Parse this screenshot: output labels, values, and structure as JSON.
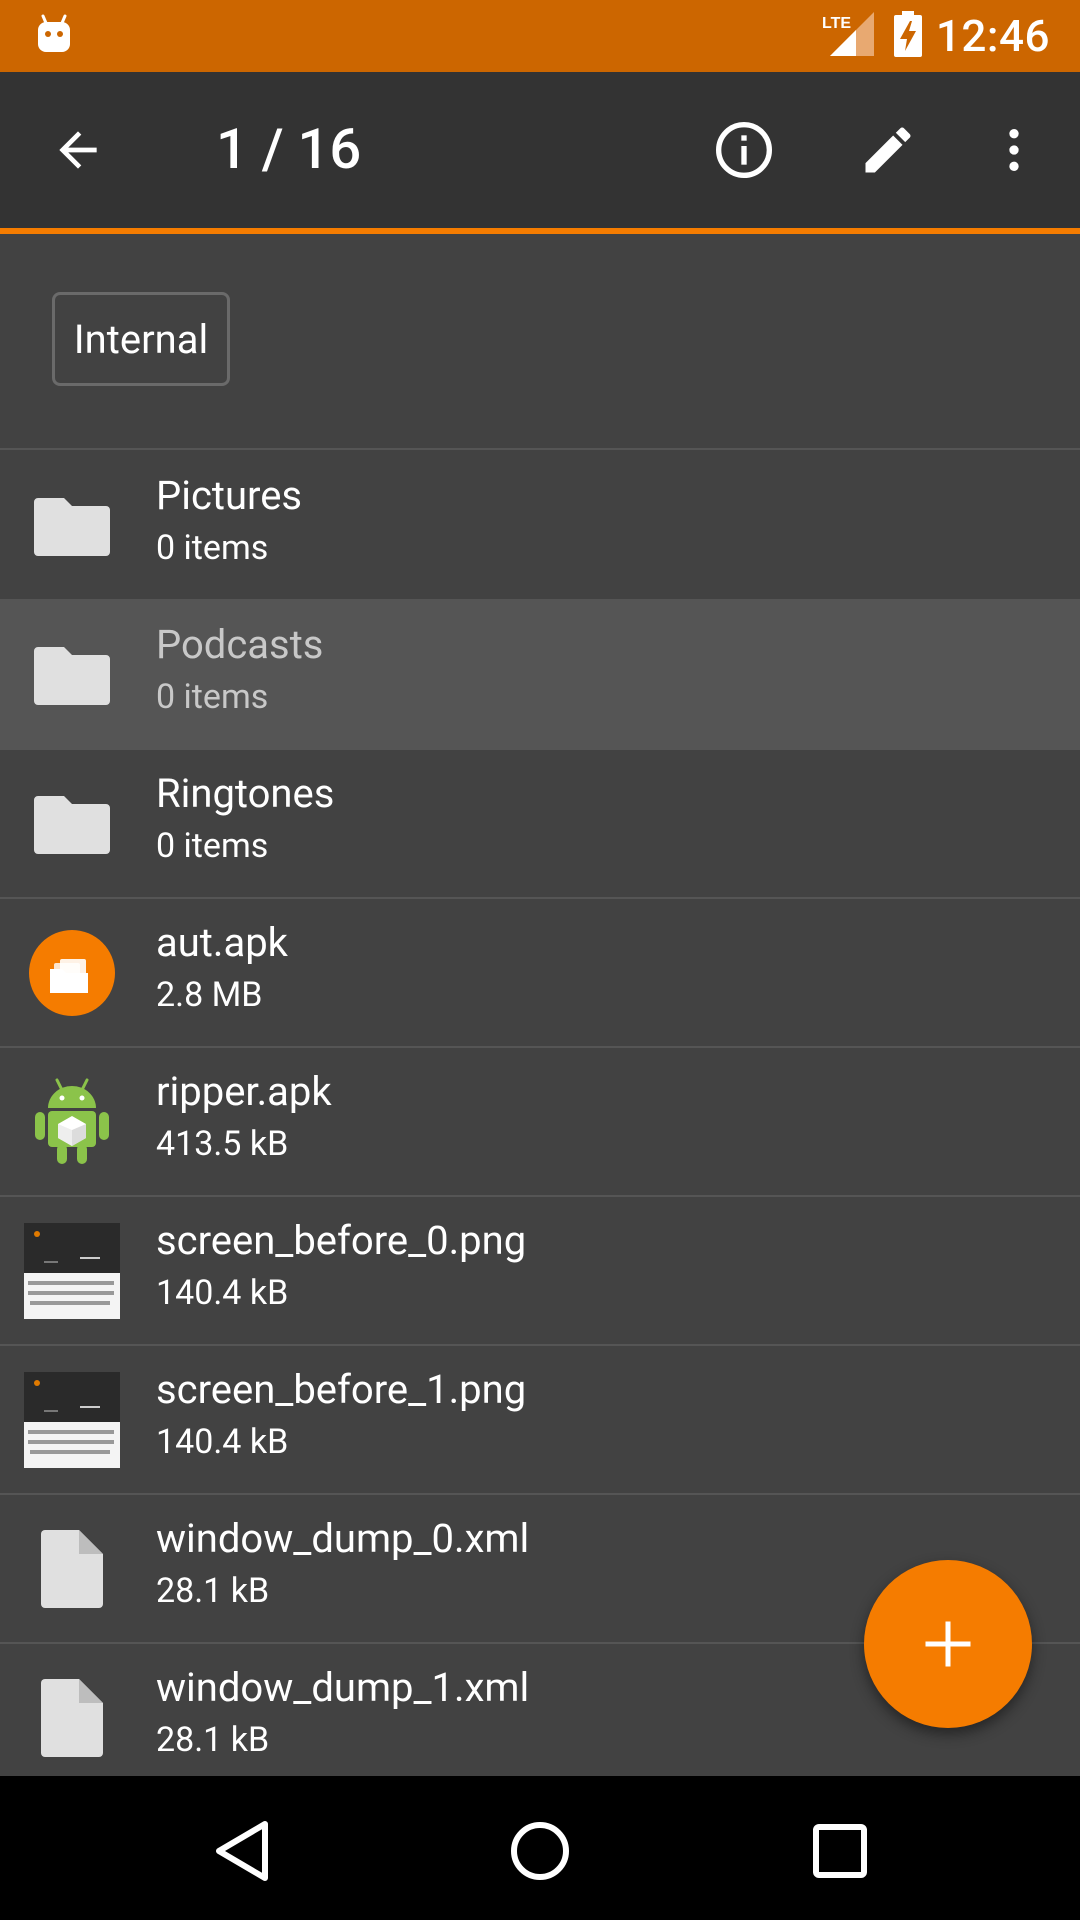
{
  "status_bar": {
    "time": "12:46",
    "network": "LTE",
    "icons": [
      "android-debug-icon",
      "lte-signal-icon",
      "battery-charging-icon"
    ]
  },
  "toolbar": {
    "title": "1 / 16",
    "icons": [
      "back-arrow-icon",
      "info-icon",
      "edit-pencil-icon",
      "more-vert-icon"
    ]
  },
  "breadcrumb": {
    "label": "Internal"
  },
  "files": [
    {
      "name": "Pictures",
      "detail": "0 items",
      "icon": "folder-icon"
    },
    {
      "name": "Podcasts",
      "detail": "0 items",
      "icon": "folder-icon"
    },
    {
      "name": "Ringtones",
      "detail": "0 items",
      "icon": "folder-icon"
    },
    {
      "name": "aut.apk",
      "detail": "2.8 MB",
      "icon": "app-apk-icon"
    },
    {
      "name": "ripper.apk",
      "detail": "413.5 kB",
      "icon": "android-apk-icon"
    },
    {
      "name": "screen_before_0.png",
      "detail": "140.4 kB",
      "icon": "image-thumbnail"
    },
    {
      "name": "screen_before_1.png",
      "detail": "140.4 kB",
      "icon": "image-thumbnail"
    },
    {
      "name": "window_dump_0.xml",
      "detail": "28.1 kB",
      "icon": "file-icon"
    },
    {
      "name": "window_dump_1.xml",
      "detail": "28.1 kB",
      "icon": "file-icon"
    }
  ],
  "fab": {
    "icon": "plus-icon"
  },
  "nav_bar": {
    "icons": [
      "nav-back-icon",
      "nav-home-icon",
      "nav-recents-icon"
    ]
  },
  "colors": {
    "accent": "#F57C00",
    "status_bar": "#CC6600",
    "toolbar": "#333333",
    "background": "#424242",
    "selected_row": "#555555"
  }
}
